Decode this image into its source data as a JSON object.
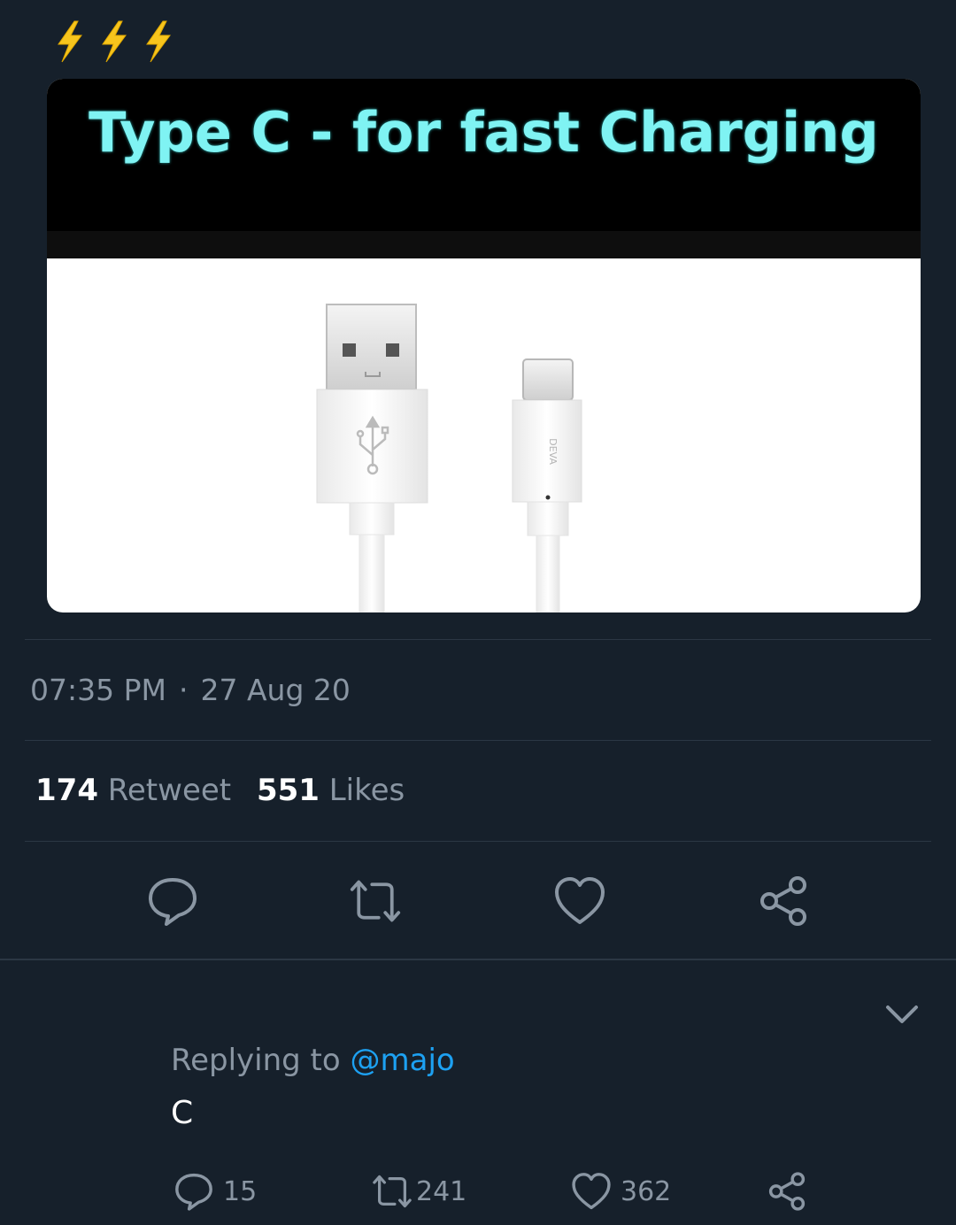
{
  "tweet": {
    "emoji": [
      "high-voltage-emoji",
      "high-voltage-emoji",
      "high-voltage-emoji"
    ],
    "media": {
      "title": "Type C - for fast Charging",
      "cable_brand": "DEVA"
    },
    "time": "07:35 PM",
    "separator": "·",
    "date": "27 Aug 20",
    "stats": {
      "retweets_count": "174",
      "retweets_label": "Retweet",
      "likes_count": "551",
      "likes_label": "Likes"
    },
    "actions": [
      "reply-icon",
      "retweet-icon",
      "like-icon",
      "share-icon"
    ]
  },
  "reply": {
    "replying_prefix": "Replying to",
    "replying_handle": "@majo",
    "text": "C",
    "reply_count": "15",
    "retweet_count": "241",
    "like_count": "362"
  },
  "colors": {
    "background": "#16202b",
    "divider": "#2b3744",
    "muted_text": "#8a96a3",
    "link": "#1da1f2",
    "title_cyan": "#7ff3f3",
    "bolt_yellow": "#f7c51d"
  }
}
